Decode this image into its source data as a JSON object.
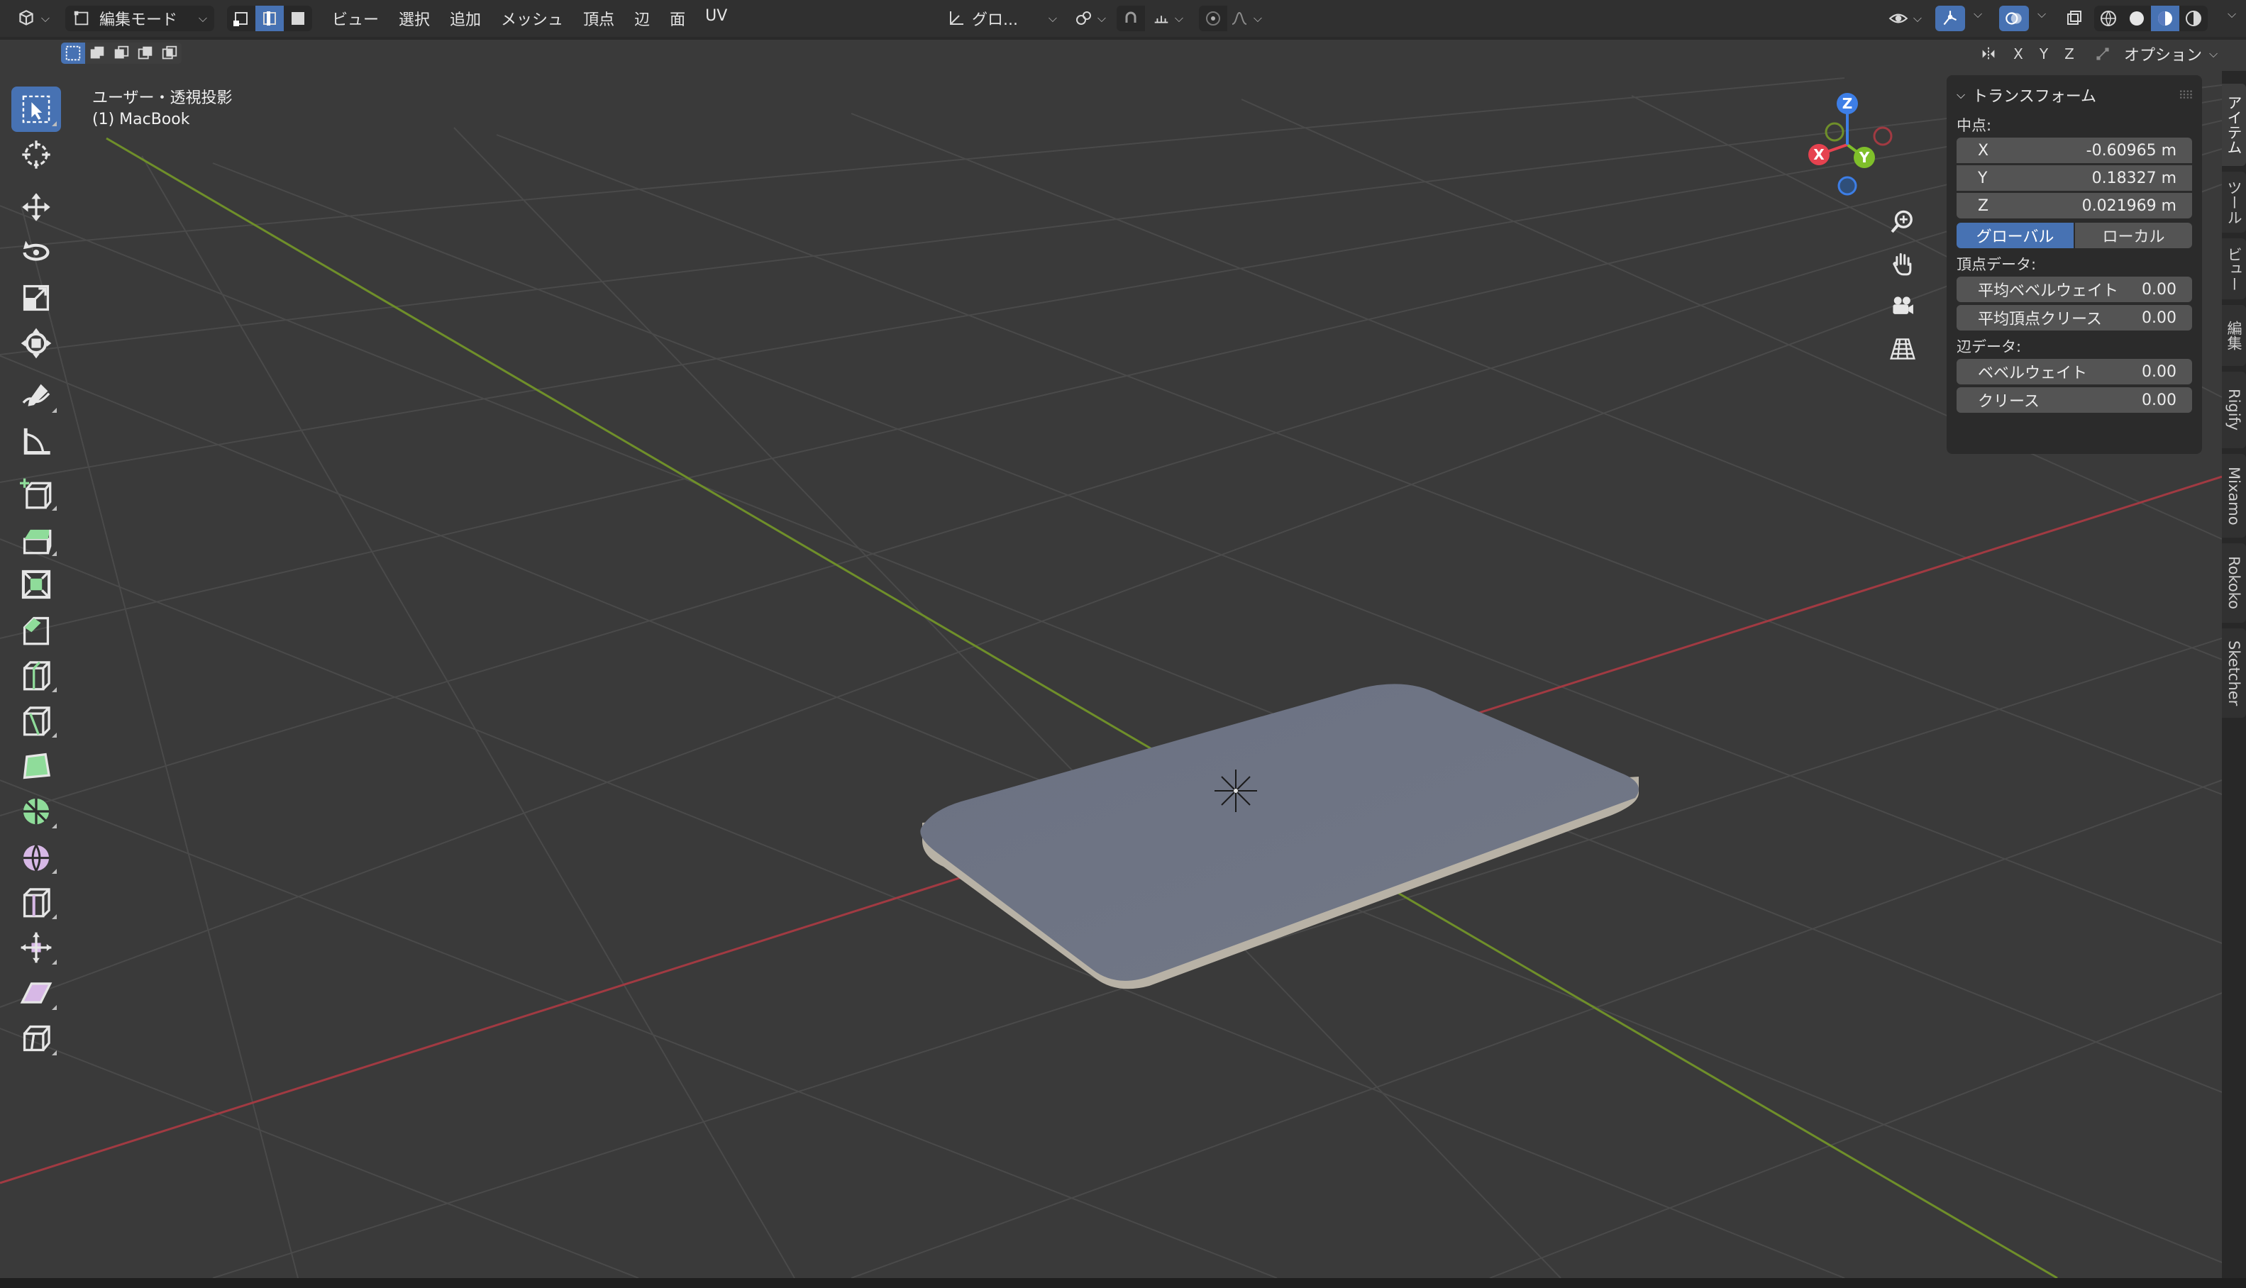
{
  "header": {
    "editor_type_icon": "editor-type-icon",
    "mode_label": "編集モード",
    "select_modes": [
      "vertex-select-icon",
      "edge-select-icon",
      "face-select-icon"
    ],
    "menus": [
      "ビュー",
      "選択",
      "追加",
      "メッシュ",
      "頂点",
      "辺",
      "面",
      "UV"
    ],
    "orientation_label": "グロ...",
    "pivot_icon": "pivot-icon",
    "snap_icon": "snap-icon",
    "proportional_icon": "proportional-icon",
    "falloff_icon": "falloff-icon",
    "right_icons": [
      "visibility-icon",
      "gizmo-icon",
      "overlay-icon",
      "xray-icon",
      "wireframe-shading-icon",
      "solid-shading-icon",
      "material-shading-icon",
      "rendered-shading-icon"
    ]
  },
  "header2": {
    "select_box_icons": [
      "select-new-icon",
      "select-extend-icon",
      "select-subtract-icon",
      "select-invert-icon",
      "select-intersect-icon"
    ],
    "mirror_icon": "mirror-icon",
    "axes": [
      "X",
      "Y",
      "Z"
    ],
    "options_label": "オプション"
  },
  "viewport": {
    "view_name": "ユーザー・透視投影",
    "object_name": "(1) MacBook"
  },
  "gizmo": {
    "x_label": "X",
    "y_label": "Y",
    "z_label": "Z"
  },
  "nav_buttons": [
    "zoom-icon",
    "pan-hand-icon",
    "camera-icon",
    "perspective-grid-icon"
  ],
  "toolbar": [
    "select-box-tool-icon",
    "cursor-tool-icon",
    "move-tool-icon",
    "rotate-tool-icon",
    "scale-tool-icon",
    "transform-tool-icon",
    "annotate-tool-icon",
    "measure-tool-icon",
    "add-cube-tool-icon",
    "extrude-tool-icon",
    "inset-tool-icon",
    "bevel-tool-icon",
    "loop-cut-tool-icon",
    "knife-tool-icon",
    "poly-build-tool-icon",
    "spin-tool-icon",
    "smooth-tool-icon",
    "edge-slide-tool-icon",
    "shrink-fatten-tool-icon",
    "shear-tool-icon",
    "rip-region-tool-icon"
  ],
  "npanel": {
    "section_title": "トランスフォーム",
    "median_label": "中点:",
    "x_label": "X",
    "x_value": "-0.60965 m",
    "y_label": "Y",
    "y_value": "0.18327 m",
    "z_label": "Z",
    "z_value": "0.021969 m",
    "global_label": "グローバル",
    "local_label": "ローカル",
    "vertex_data_label": "頂点データ:",
    "mean_bevel_weight_label": "平均ベベルウェイト",
    "mean_bevel_weight_value": "0.00",
    "mean_vertex_crease_label": "平均頂点クリース",
    "mean_vertex_crease_value": "0.00",
    "edge_data_label": "辺データ:",
    "bevel_weight_label": "ベベルウェイト",
    "bevel_weight_value": "0.00",
    "crease_label": "クリース",
    "crease_value": "0.00"
  },
  "right_tabs": [
    "アイテム",
    "ツール",
    "ビュー",
    "編集",
    "Rigify",
    "Mixamo",
    "Rokoko",
    "Sketcher"
  ],
  "colors": {
    "accent": "#4772b3",
    "x_axis": "#e6424f",
    "y_axis": "#7fbf2a",
    "z_axis": "#3d7ee6",
    "mesh_top": "#6f7585",
    "mesh_edge": "#b8b2a6"
  }
}
